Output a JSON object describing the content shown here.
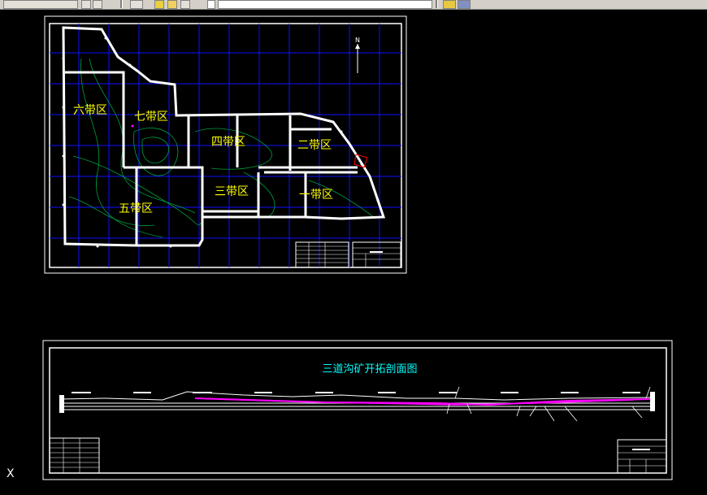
{
  "toolbar": {
    "buttons": [
      "layer-button",
      "layer-states-button",
      "match-properties-button",
      "bulb-icon",
      "sun-icon",
      "lock-icon",
      "color-swatch",
      "layer-dropdown"
    ],
    "right_icons": [
      "ucs-icon",
      "ucs-3d-icon"
    ]
  },
  "plan_map": {
    "north_label": "N",
    "zones": [
      {
        "id": "zone-6",
        "label": "六带区"
      },
      {
        "id": "zone-7",
        "label": "七带区"
      },
      {
        "id": "zone-4",
        "label": "四带区"
      },
      {
        "id": "zone-2",
        "label": "二带区"
      },
      {
        "id": "zone-3",
        "label": "三带区"
      },
      {
        "id": "zone-1",
        "label": "一带区"
      },
      {
        "id": "zone-5",
        "label": "五带区"
      }
    ]
  },
  "section": {
    "title": "三道沟矿开拓剖面图"
  },
  "ucs_label": "X",
  "colors": {
    "background": "#000000",
    "frame": "#ffffff",
    "grid": "#1010ff",
    "zone_text": "#ffff00",
    "title_text": "#00ffff",
    "contour": "#00a040",
    "profile": "#ff00ff",
    "accent": "#ff0000"
  }
}
